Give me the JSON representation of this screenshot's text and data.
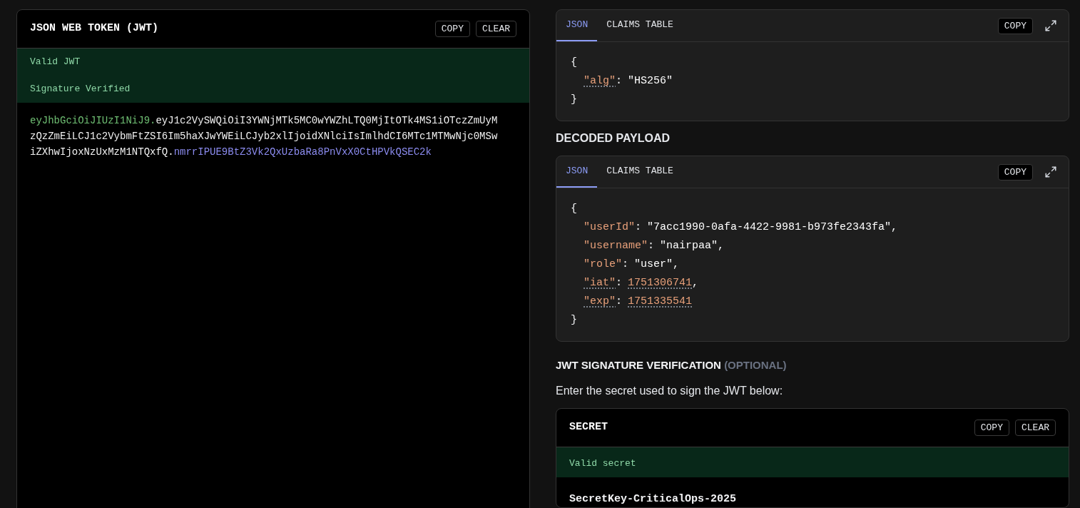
{
  "token_panel": {
    "title": "JSON WEB TOKEN (JWT)",
    "buttons": [
      "COPY",
      "CLEAR"
    ],
    "statuses": [
      "Valid JWT",
      "Signature Verified"
    ],
    "token_parts": [
      {
        "kind": "header",
        "text": "eyJhbGciOiJIUzI1NiJ9."
      },
      {
        "kind": "payload",
        "text": "eyJ1c2VySWQiOiI3YWNjMTk5MC0wYWZhLTQ0MjItOTk4MS1iOTczZmUyMzQzZmEiLCJ1c2VybmFtZSI6Im5haXJwYWEiLCJyb2xlIjoidXNlciIsImlhdCI6MTc1MTMwNjc0MSwiZXhwIjoxNzUxMzM1NTQxfQ."
      },
      {
        "kind": "signature",
        "text": "nmrrIPUE9BtZ3Vk2QxUzbaRa8PnVxX0CtHPVkQSEC2k"
      }
    ]
  },
  "decoded_header": {
    "tabs": [
      {
        "label": "JSON",
        "selected": true
      },
      {
        "label": "CLAIMS TABLE",
        "selected": false
      }
    ],
    "copy_button": "COPY",
    "open": "{",
    "close": "}",
    "claims": [
      {
        "key": "\"alg\"",
        "colon": ":",
        "value": "\"HS256\"",
        "kind": "string",
        "annotated": true
      }
    ]
  },
  "payload_heading": "DECODED PAYLOAD",
  "decoded_payload": {
    "tabs": [
      {
        "label": "JSON",
        "selected": true
      },
      {
        "label": "CLAIMS TABLE",
        "selected": false
      }
    ],
    "copy_button": "COPY",
    "open": "{",
    "close": "}",
    "claims": [
      {
        "key": "\"userId\"",
        "colon": ":",
        "value": "\"7acc1990-0afa-4422-9981-b973fe2343fa\"",
        "kind": "string",
        "annotated": false,
        "comma": ","
      },
      {
        "key": "\"username\"",
        "colon": ":",
        "value": "\"nairpaa\"",
        "kind": "string",
        "annotated": false,
        "comma": ","
      },
      {
        "key": "\"role\"",
        "colon": ":",
        "value": "\"user\"",
        "kind": "string",
        "annotated": false,
        "comma": ","
      },
      {
        "key": "\"iat\"",
        "colon": ":",
        "value": "1751306741",
        "kind": "number",
        "annotated": true,
        "comma": ","
      },
      {
        "key": "\"exp\"",
        "colon": ":",
        "value": "1751335541",
        "kind": "number",
        "annotated": true
      }
    ]
  },
  "verification": {
    "heading": "JWT SIGNATURE VERIFICATION",
    "heading_note": "(OPTIONAL)",
    "description": "Enter the secret used to sign the JWT below:",
    "secret_panel": {
      "title": "SECRET",
      "buttons": [
        "COPY",
        "CLEAR"
      ],
      "status": "Valid secret",
      "value": "SecretKey-CriticalOps-2025"
    }
  }
}
